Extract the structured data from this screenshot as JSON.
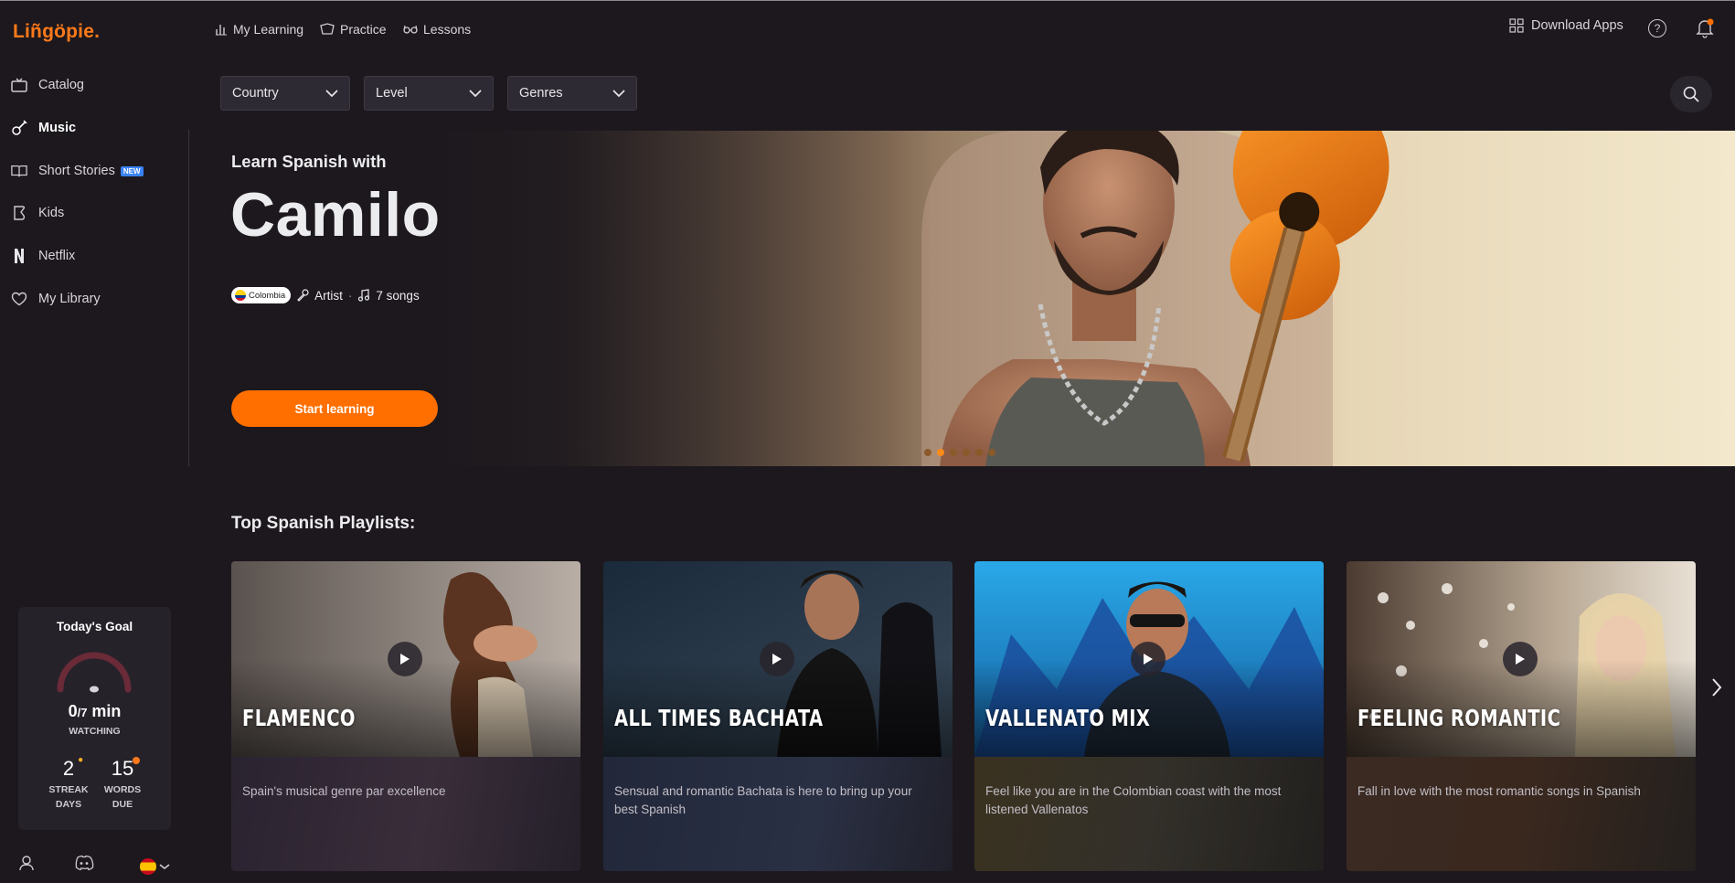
{
  "brand": {
    "logo": "Liñgöpie."
  },
  "sidebar": {
    "items": [
      {
        "label": "Catalog",
        "icon": "tv-icon"
      },
      {
        "label": "Music",
        "icon": "guitar-icon",
        "active": true
      },
      {
        "label": "Short Stories",
        "icon": "book-icon",
        "badge": "NEW"
      },
      {
        "label": "Kids",
        "icon": "kids-icon"
      },
      {
        "label": "Netflix",
        "icon": "netflix-icon"
      },
      {
        "label": "My Library",
        "icon": "heart-icon"
      }
    ],
    "goal": {
      "title": "Today's Goal",
      "minutes": "0",
      "target": "/7",
      "unit": " min",
      "progress": 0,
      "label": "WATCHING",
      "streak_value": "2",
      "streak_label_1": "STREAK",
      "streak_label_2": "DAYS",
      "words_value": "15",
      "words_label_1": "WORDS",
      "words_label_2": "DUE"
    }
  },
  "topnav": {
    "my_learning": "My Learning",
    "practice": "Practice",
    "lessons": "Lessons",
    "download_apps": "Download Apps"
  },
  "filters": {
    "country": "Country",
    "level": "Level",
    "genres": "Genres"
  },
  "hero": {
    "kicker": "Learn Spanish with",
    "title": "Camilo",
    "country": "Colombia",
    "role": "Artist",
    "songs": "7 songs",
    "separator": "·",
    "cta": "Start learning",
    "slides": 6,
    "active_slide": 1
  },
  "playlists": {
    "title": "Top Spanish Playlists:",
    "items": [
      {
        "name": "FLAMENCO",
        "description": "Spain's musical genre par excellence"
      },
      {
        "name": "ALL TIMES BACHATA",
        "description": "Sensual and romantic Bachata is here to bring up your best Spanish"
      },
      {
        "name": "VALLENATO MIX",
        "description": "Feel like you are in the Colombian coast with the most listened Vallenatos"
      },
      {
        "name": "FEELING ROMANTIC",
        "description": "Fall in love with the most romantic songs in Spanish"
      }
    ]
  },
  "colors": {
    "accent": "#ff6f00",
    "background": "#1c181d",
    "panel": "#26222a"
  }
}
